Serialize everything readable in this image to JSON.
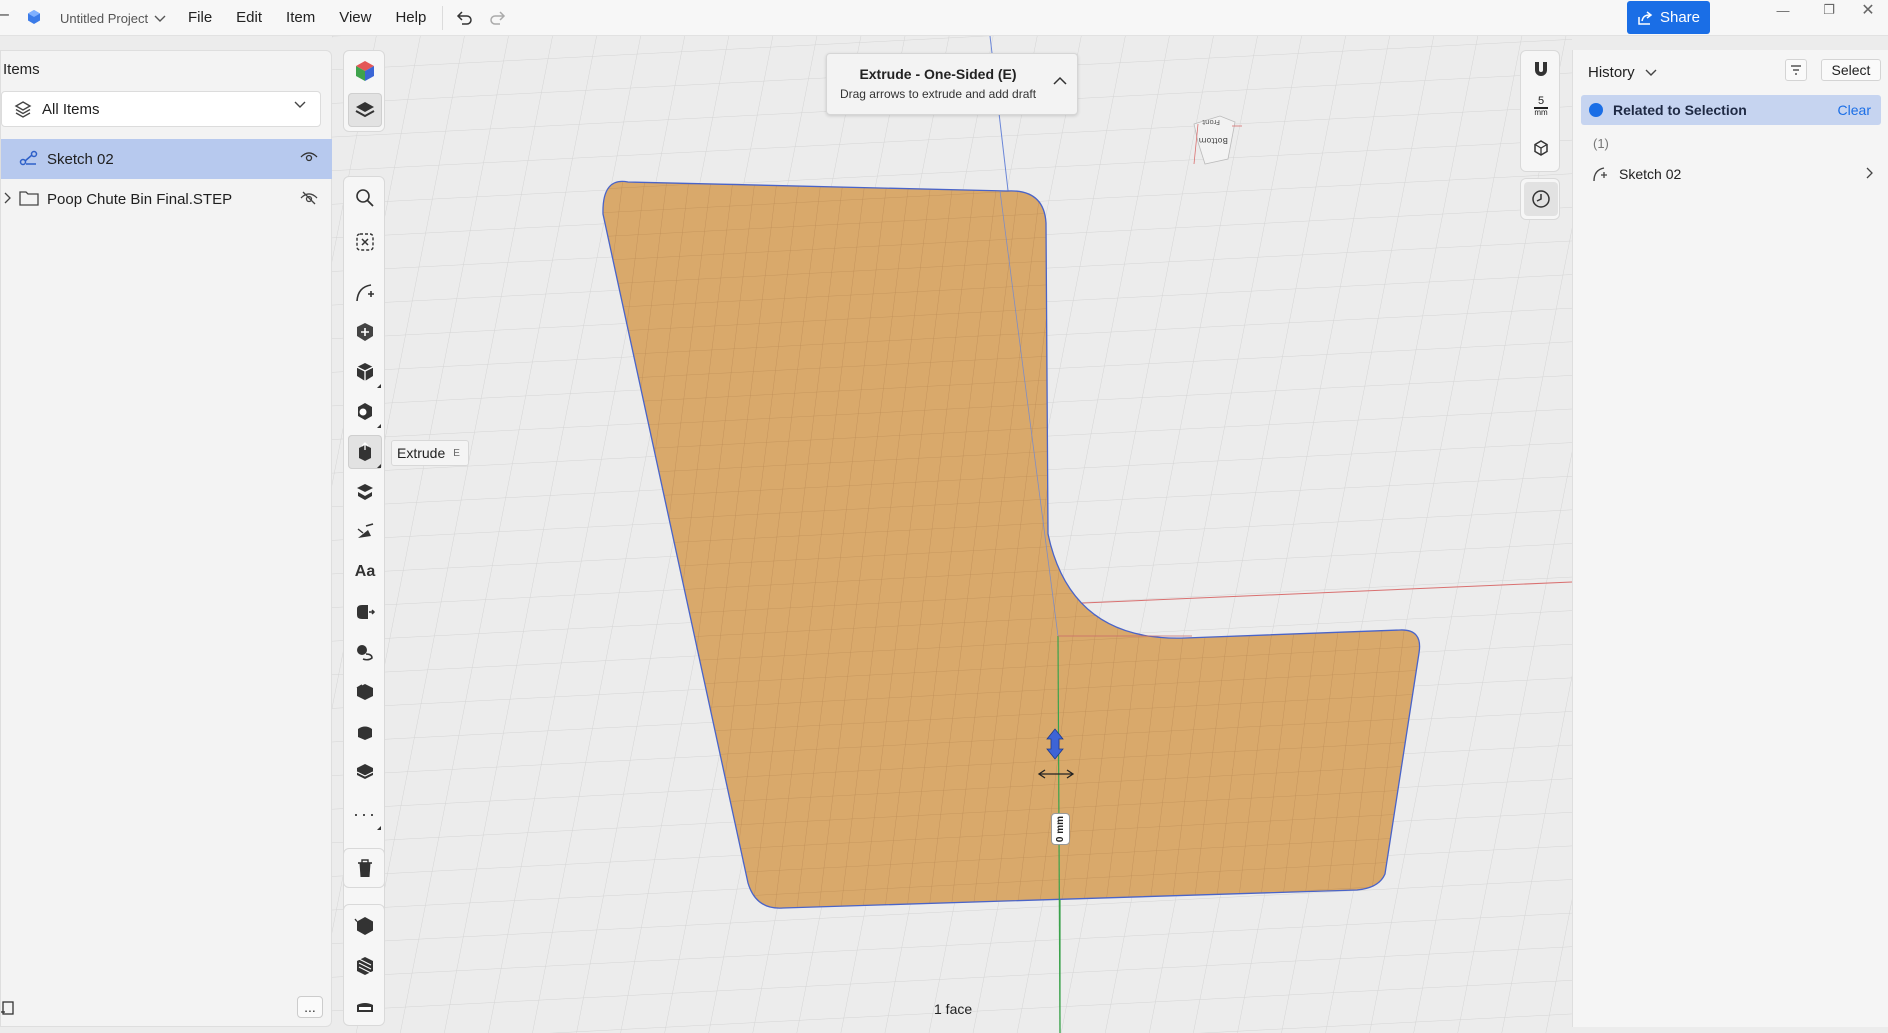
{
  "titlebar": {
    "project_title": "Untitled Project",
    "menu": [
      "File",
      "Edit",
      "Item",
      "View",
      "Help"
    ],
    "share_label": "Share",
    "window_controls": [
      "minimize-icon",
      "restore-icon",
      "close-icon"
    ]
  },
  "left_panel": {
    "title": "Items",
    "filter_label": "All Items",
    "tree": [
      {
        "label": "Sketch 02",
        "icon": "sketch-icon",
        "visible": true,
        "selected": true
      },
      {
        "label": "Poop Chute Bin Final.STEP",
        "icon": "folder-icon",
        "visible": false,
        "selected": false
      }
    ],
    "more_label": "..."
  },
  "tooltip": {
    "label": "Extrude",
    "shortcut": "E"
  },
  "op_banner": {
    "title": "Extrude - One-Sided (E)",
    "subtitle": "Drag arrows to extrude and add draft"
  },
  "view_strip": {
    "snap_value": "5",
    "snap_unit": "mm"
  },
  "view_cube": {
    "face_top": "Front",
    "face_main": "Bottom"
  },
  "viewport": {
    "dimension_label": "0 mm",
    "status": "1 face"
  },
  "right_panel": {
    "history_label": "History",
    "select_label": "Select",
    "related_label": "Related to Selection",
    "clear_label": "Clear",
    "count": "(1)",
    "items": [
      {
        "label": "Sketch 02",
        "icon": "sketch-icon"
      }
    ]
  },
  "colors": {
    "accent": "#1a6ee6",
    "selection": "#b7c9ee",
    "sketch_fill": "#d9a96b",
    "sketch_edge": "#4a64c8"
  }
}
